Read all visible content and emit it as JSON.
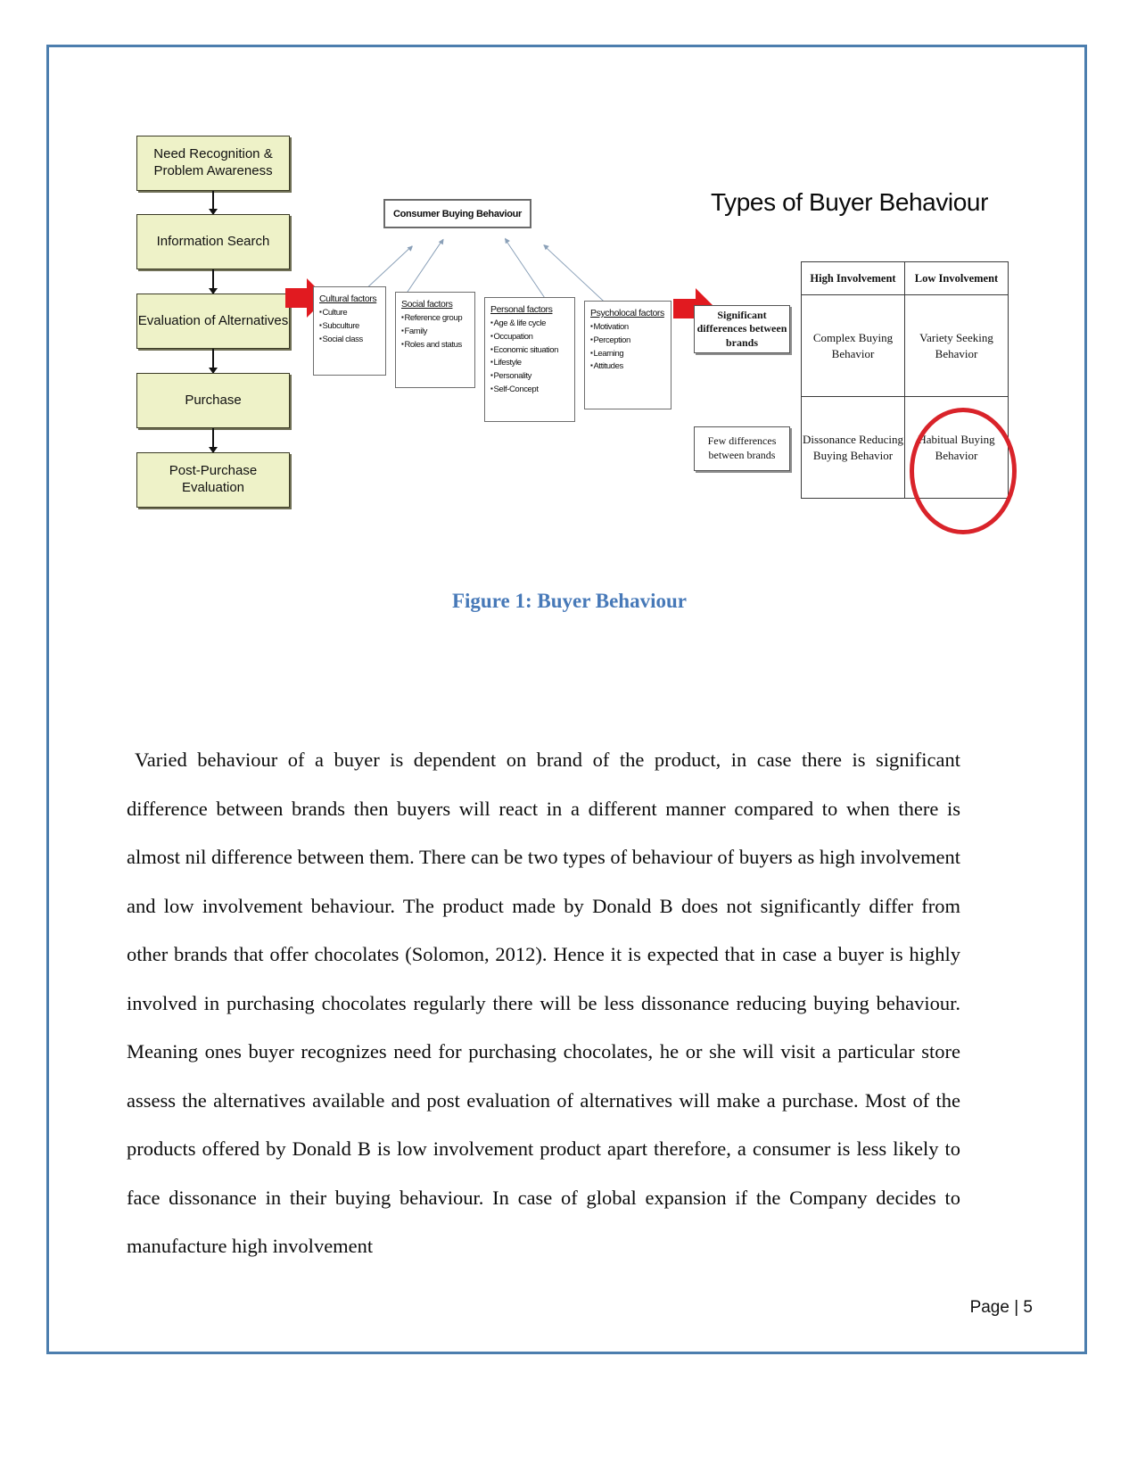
{
  "page": {
    "border_color": "#4c7eae",
    "footer": "Page | 5"
  },
  "figure": {
    "caption": "Figure 1: Buyer Behaviour",
    "caption_color": "#4779b8",
    "flowchart": {
      "steps": [
        "Need Recognition & Problem Awareness",
        "Information Search",
        "Evaluation of Alternatives",
        "Purchase",
        "Post-Purchase Evaluation"
      ],
      "box_fill": "#eef2c8"
    },
    "consumer_model": {
      "header": "Consumer Buying Behaviour",
      "factor_groups": [
        {
          "title": "Cultural factors",
          "items": [
            "Culture",
            "Subculture",
            "Social class"
          ]
        },
        {
          "title": "Social factors",
          "items": [
            "Reference group",
            "Family",
            "Roles and status"
          ]
        },
        {
          "title": "Personal factors",
          "items": [
            "Age & life cycle",
            "Occupation",
            "Economic situation",
            "Lifestyle",
            "Personality",
            "Self-Concept"
          ]
        },
        {
          "title": "Psycholocal factors",
          "items": [
            "Motivation",
            "Perception",
            "Learning",
            "Attitudes"
          ]
        }
      ]
    },
    "brand_difference": {
      "significant": "Significant differences between brands",
      "few": "Few differences between brands"
    },
    "types_matrix": {
      "title": "Types of Buyer Behaviour",
      "columns": [
        "High Involvement",
        "Low Involvement"
      ],
      "rows": [
        [
          "Complex Buying Behavior",
          "Variety Seeking Behavior"
        ],
        [
          "Dissonance Reducing Buying Behavior",
          "Habitual Buying Behavior"
        ]
      ],
      "highlight_color": "#d9232a",
      "highlighted_cell": "Habitual Buying Behavior"
    },
    "arrow_color": "#e11a20"
  },
  "body": {
    "paragraph": "Varied behaviour of a buyer is dependent on brand of the product, in case there is significant difference between brands then buyers will react in a different manner compared to when there is almost nil difference between them. There can be two types of behaviour of buyers as high involvement and low involvement behaviour. The product made by Donald B does not significantly differ from other brands that offer chocolates (Solomon, 2012). Hence it is expected that in case a buyer is highly involved in purchasing chocolates regularly there will be less dissonance reducing buying behaviour. Meaning ones buyer recognizes need for purchasing chocolates, he or she will visit a particular store assess the alternatives available and post evaluation of alternatives will make a purchase. Most of the products offered by Donald B is low involvement product apart therefore, a consumer is less likely to face dissonance in their buying behaviour. In case of global expansion if the Company decides to manufacture high involvement"
  }
}
